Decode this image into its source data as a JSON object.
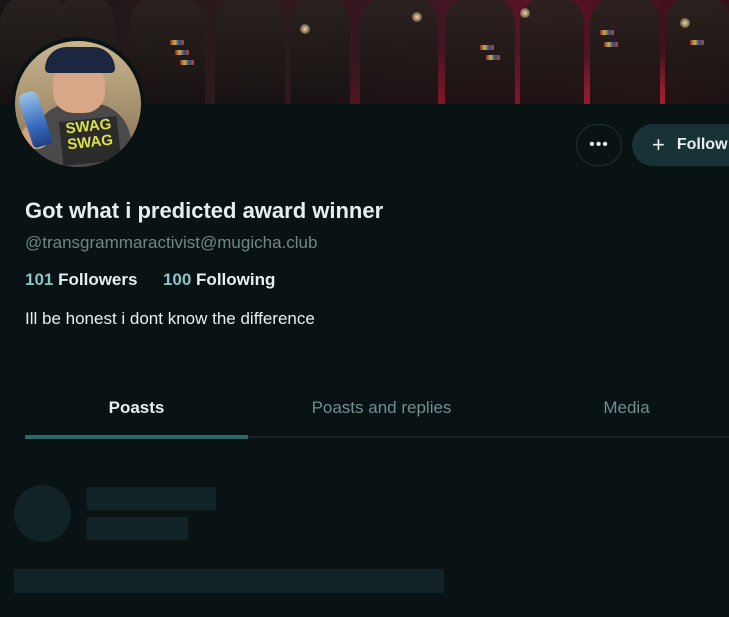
{
  "profile": {
    "display_name": "Got what i predicted award winner",
    "handle": "@transgrammaractivist@mugicha.club",
    "followers_count": "101",
    "followers_label": "Followers",
    "following_count": "100",
    "following_label": "Following",
    "bio": "Ill be honest i dont know the difference",
    "avatar_shirt_text": "SWAG SWAG"
  },
  "actions": {
    "more_label": "•••",
    "follow_label": "Follow",
    "follow_icon": "+"
  },
  "tabs": [
    {
      "label": "Poasts",
      "active": true
    },
    {
      "label": "Poasts and replies",
      "active": false
    },
    {
      "label": "Media",
      "active": false
    }
  ],
  "colors": {
    "background": "#0a1314",
    "accent": "#8ec3c6",
    "follow_button_bg": "#183235",
    "tab_underline": "#2d6a6e",
    "skeleton": "#112326"
  },
  "icons": {
    "more": "more-horizontal-icon",
    "follow": "plus-icon"
  }
}
